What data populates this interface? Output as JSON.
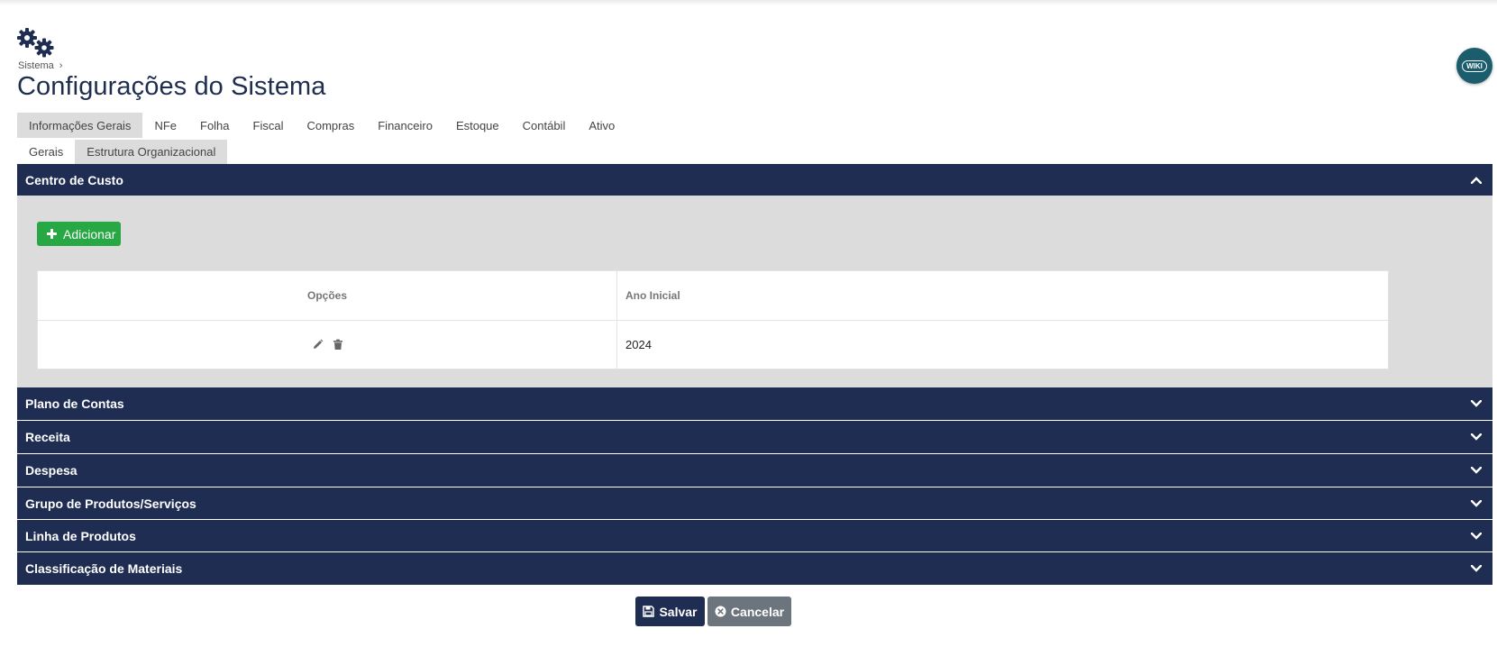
{
  "breadcrumb": {
    "root": "Sistema"
  },
  "page_title": "Configurações do Sistema",
  "wiki_label": "WIKI",
  "tabs_main": [
    "Informações Gerais",
    "NFe",
    "Folha",
    "Fiscal",
    "Compras",
    "Financeiro",
    "Estoque",
    "Contábil",
    "Ativo"
  ],
  "tabs_main_active": "Informações Gerais",
  "tabs_sub": [
    "Gerais",
    "Estrutura Organizacional"
  ],
  "tabs_sub_active": "Estrutura Organizacional",
  "sections": {
    "centro_custo": {
      "title": "Centro de Custo",
      "add_label": "Adicionar",
      "table": {
        "headers": {
          "opcoes": "Opções",
          "ano": "Ano Inicial"
        },
        "rows": [
          {
            "ano": "2024"
          }
        ]
      }
    },
    "plano_contas": "Plano de Contas",
    "receita": "Receita",
    "despesa": "Despesa",
    "grupo": "Grupo de Produtos/Serviços",
    "linha": "Linha de Produtos",
    "classificacao": "Classificação de Materiais"
  },
  "footer": {
    "save_label": "Salvar",
    "cancel_label": "Cancelar"
  },
  "colors": {
    "navy": "#1f2d53",
    "green": "#28a745",
    "gray": "#6c757d",
    "panel": "#dcdcdc"
  }
}
